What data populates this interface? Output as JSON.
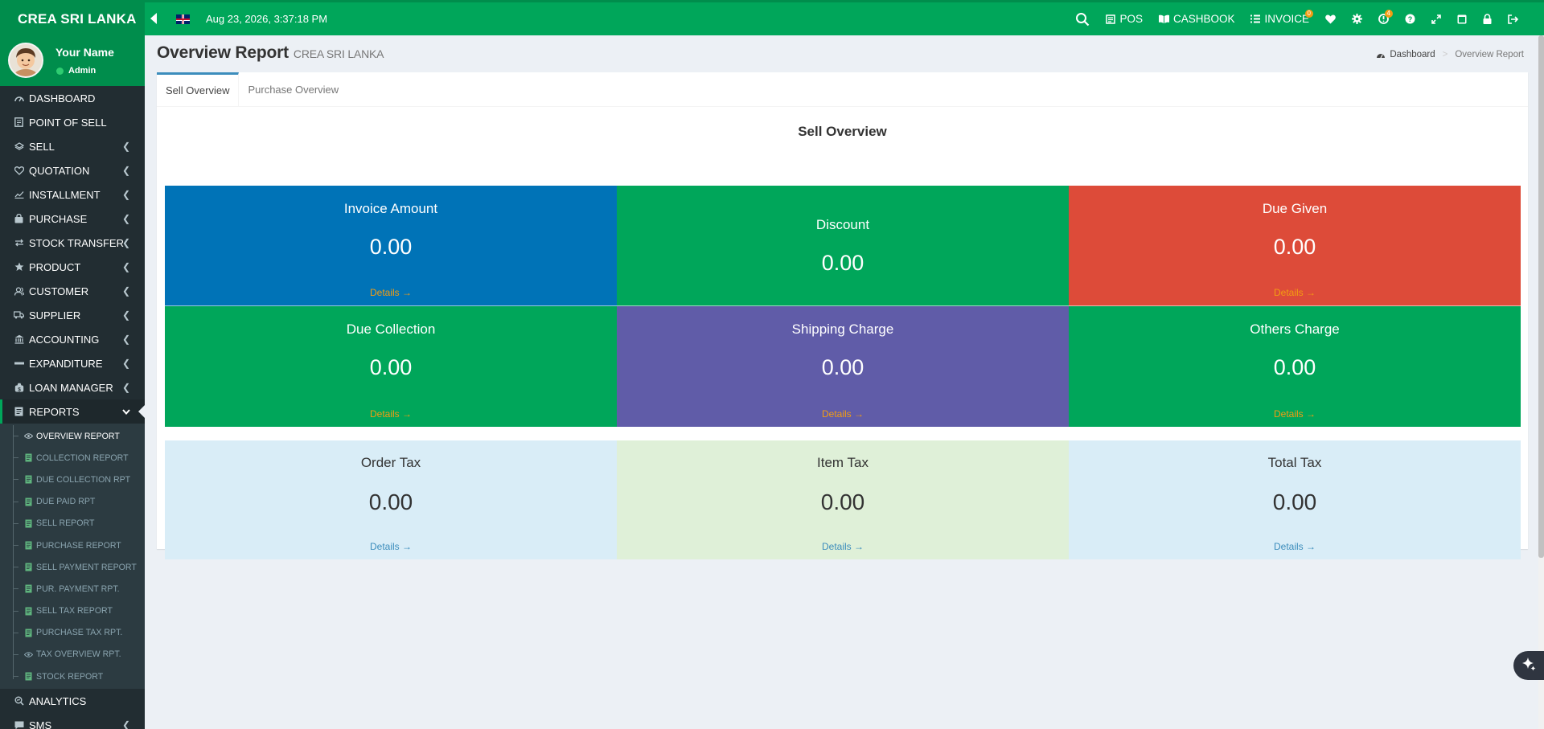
{
  "app": {
    "brand": "CREA SRI LANKA",
    "datetime": "Aug 23, 2026, 3:37:18 PM"
  },
  "topnav": [
    {
      "key": "search",
      "label": "",
      "icon": "search-icon"
    },
    {
      "key": "pos",
      "label": "POS",
      "icon": "pos-icon"
    },
    {
      "key": "cashbook",
      "label": "CASHBOOK",
      "icon": "book-icon"
    },
    {
      "key": "invoice",
      "label": "INVOICE",
      "icon": "list-icon",
      "badge": "0"
    },
    {
      "key": "favorite",
      "label": "",
      "icon": "heart-icon"
    },
    {
      "key": "settings",
      "label": "",
      "icon": "gear-icon"
    },
    {
      "key": "alerts",
      "label": "",
      "icon": "alert-icon",
      "badge": "4"
    },
    {
      "key": "help",
      "label": "",
      "icon": "help-icon"
    },
    {
      "key": "fullscreen",
      "label": "",
      "icon": "expand-icon"
    },
    {
      "key": "window",
      "label": "",
      "icon": "window-icon"
    },
    {
      "key": "lock",
      "label": "",
      "icon": "lock-icon"
    },
    {
      "key": "logout",
      "label": "",
      "icon": "logout-icon"
    }
  ],
  "user": {
    "name": "Your Name",
    "role": "Admin"
  },
  "sidebar": {
    "items": [
      {
        "label": "DASHBOARD",
        "icon": "dashboard-icon",
        "caret": false
      },
      {
        "label": "POINT OF SELL",
        "icon": "pos-icon",
        "caret": false
      },
      {
        "label": "SELL",
        "icon": "money-icon",
        "caret": true
      },
      {
        "label": "QUOTATION",
        "icon": "heart-outline-icon",
        "caret": true
      },
      {
        "label": "INSTALLMENT",
        "icon": "chart-icon",
        "caret": true
      },
      {
        "label": "PURCHASE",
        "icon": "bag-icon",
        "caret": true
      },
      {
        "label": "STOCK TRANSFER",
        "icon": "transfer-icon",
        "caret": true
      },
      {
        "label": "PRODUCT",
        "icon": "star-icon",
        "caret": true
      },
      {
        "label": "CUSTOMER",
        "icon": "users-icon",
        "caret": true
      },
      {
        "label": "SUPPLIER",
        "icon": "truck-icon",
        "caret": true
      },
      {
        "label": "ACCOUNTING",
        "icon": "bank-icon",
        "caret": true
      },
      {
        "label": "EXPANDITURE",
        "icon": "minus-icon",
        "caret": true
      },
      {
        "label": "LOAN MANAGER",
        "icon": "loan-icon",
        "caret": true
      },
      {
        "label": "REPORTS",
        "icon": "report-icon",
        "caret": true,
        "active": true
      }
    ],
    "reports_sub": [
      {
        "label": "OVERVIEW REPORT",
        "icon": "eye-icon",
        "current": true
      },
      {
        "label": "COLLECTION REPORT",
        "icon": "file-icon"
      },
      {
        "label": "DUE COLLECTION RPT",
        "icon": "file-icon"
      },
      {
        "label": "DUE PAID RPT",
        "icon": "file-icon"
      },
      {
        "label": "SELL REPORT",
        "icon": "file-icon"
      },
      {
        "label": "PURCHASE REPORT",
        "icon": "file-icon"
      },
      {
        "label": "SELL PAYMENT REPORT",
        "icon": "file-icon"
      },
      {
        "label": "PUR. PAYMENT RPT.",
        "icon": "file-icon"
      },
      {
        "label": "SELL TAX REPORT",
        "icon": "file-icon"
      },
      {
        "label": "PURCHASE TAX RPT.",
        "icon": "file-icon"
      },
      {
        "label": "TAX OVERVIEW RPT.",
        "icon": "eye-icon"
      },
      {
        "label": "STOCK REPORT",
        "icon": "file-icon"
      }
    ],
    "after": [
      {
        "label": "ANALYTICS",
        "icon": "analytics-icon",
        "caret": false
      },
      {
        "label": "SMS",
        "icon": "sms-icon",
        "caret": true
      }
    ]
  },
  "page": {
    "title": "Overview Report",
    "subtitle": "CREA SRI LANKA",
    "breadcrumb": {
      "home": "Dashboard",
      "current": "Overview Report"
    }
  },
  "tabs": [
    "Sell Overview",
    "Purchase Overview"
  ],
  "section_title": "Sell Overview",
  "cards": [
    {
      "title": "Invoice Amount",
      "value": "0.00",
      "link": "Details →",
      "color": "#0073b7"
    },
    {
      "title": "Discount",
      "value": "0.00",
      "link": "",
      "color": "#00a65a"
    },
    {
      "title": "Due Given",
      "value": "0.00",
      "link": "Details →",
      "color": "#dd4b39"
    },
    {
      "title": "Due Collection",
      "value": "0.00",
      "link": "Details →",
      "color": "#00a65a"
    },
    {
      "title": "Shipping Charge",
      "value": "0.00",
      "link": "Details →",
      "color": "#605ca8"
    },
    {
      "title": "Others Charge",
      "value": "0.00",
      "link": "Details →",
      "color": "#00a65a"
    }
  ],
  "tax_cards": [
    {
      "title": "Order Tax",
      "value": "0.00",
      "link": "Details →",
      "color": "#d9edf7"
    },
    {
      "title": "Item Tax",
      "value": "0.00",
      "link": "Details →",
      "color": "#dff0d8"
    },
    {
      "title": "Total Tax",
      "value": "0.00",
      "link": "Details →",
      "color": "#d9edf7"
    }
  ]
}
